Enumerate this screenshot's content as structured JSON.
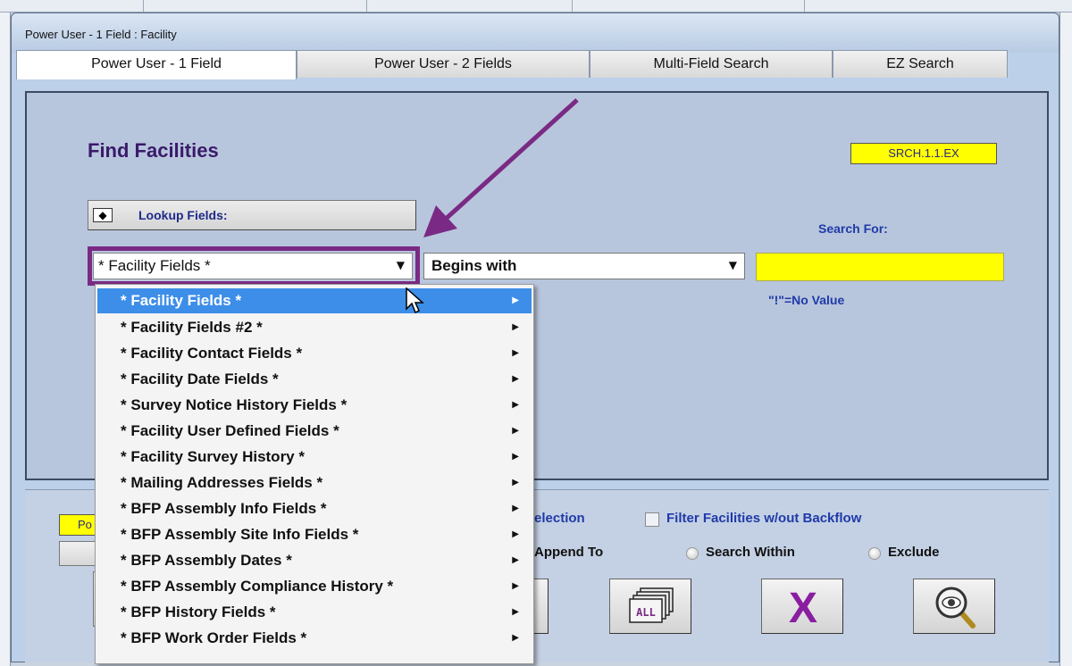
{
  "window": {
    "title": "Power User - 1 Field : Facility"
  },
  "tabs": [
    {
      "label": "Power User - 1 Field",
      "active": true
    },
    {
      "label": "Power User - 2 Fields",
      "active": false
    },
    {
      "label": "Multi-Field Search",
      "active": false
    },
    {
      "label": "EZ Search",
      "active": false
    }
  ],
  "panel": {
    "heading": "Find Facilities",
    "code": "SRCH.1.1.EX",
    "lookup_button": {
      "icon": "diamond-icon",
      "glyph": "◆",
      "label": "Lookup Fields:"
    },
    "search_for_label": "Search For:",
    "field_select": {
      "value": "* Facility Fields *"
    },
    "operator_select": {
      "value": "Begins with"
    },
    "search_input": {
      "value": ""
    },
    "no_value_hint": "\"!\"=No Value"
  },
  "bottom": {
    "yellow_label": "Po",
    "selection_label": "election",
    "append_label": "Append To",
    "filter_checkbox": {
      "label": "Filter Facilities w/out Backflow",
      "checked": false
    },
    "radios": [
      {
        "label": "Search Within",
        "checked": false
      },
      {
        "label": "Exclude",
        "checked": false
      }
    ],
    "buttons": {
      "all_label": "ALL",
      "delete_glyph": "X",
      "search_icon": "magnifier-eye-icon"
    }
  },
  "dropdown_menu": {
    "items": [
      {
        "label": "* Facility Fields *",
        "highlighted": true
      },
      {
        "label": "* Facility Fields #2 *"
      },
      {
        "label": "* Facility Contact Fields *"
      },
      {
        "label": "* Facility Date Fields *"
      },
      {
        "label": "* Survey Notice History Fields *"
      },
      {
        "label": "* Facility User Defined Fields *"
      },
      {
        "label": "* Facility Survey History *"
      },
      {
        "label": "* Mailing Addresses Fields *"
      },
      {
        "label": "* BFP Assembly Info Fields *"
      },
      {
        "label": "* BFP Assembly Site Info Fields *"
      },
      {
        "label": "* BFP Assembly Dates *"
      },
      {
        "label": "* BFP Assembly Compliance History *"
      },
      {
        "label": "* BFP History Fields *"
      },
      {
        "label": "* BFP Work Order Fields *"
      }
    ],
    "submenu_glyph": "▶"
  },
  "colors": {
    "highlight": "#3d8ee8",
    "annotation": "#7a2a84",
    "search_input": "#ffff00",
    "heading": "#3a1a6a",
    "label_blue": "#1f3aa8"
  }
}
